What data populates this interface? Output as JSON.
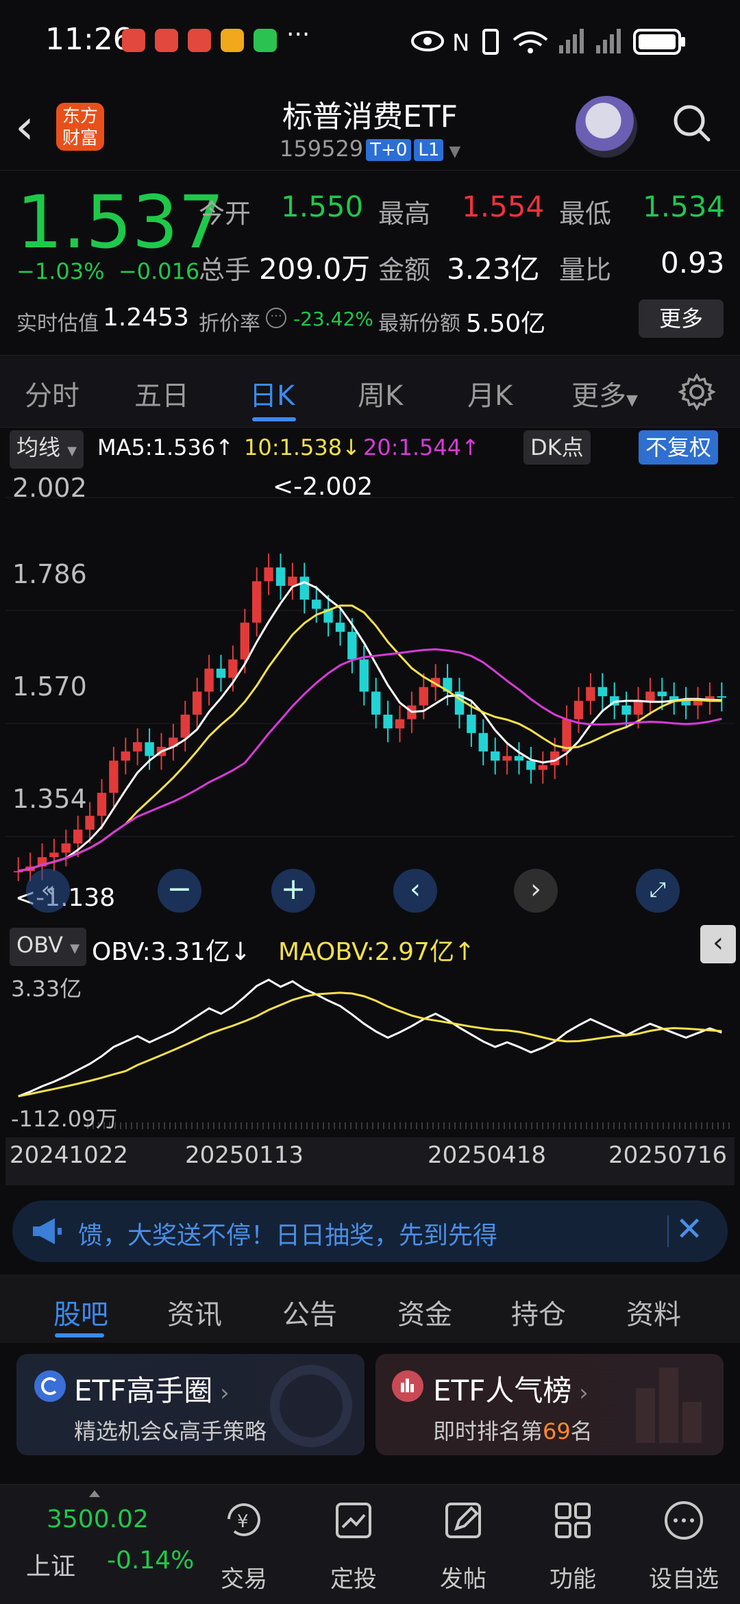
{
  "status": {
    "time": "11:26",
    "more": "···"
  },
  "header": {
    "logo_line1": "东方",
    "logo_line2": "财富",
    "title": "标普消费ETF",
    "code": "159529",
    "badge1": "T+0",
    "badge2": "L1"
  },
  "quote": {
    "price": "1.537",
    "change_pct": "−1.03%",
    "change_abs": "−0.016",
    "open_label": "今开",
    "open": "1.550",
    "high_label": "最高",
    "high": "1.554",
    "low_label": "最低",
    "low": "1.534",
    "volume_label": "总手",
    "volume": "209.0万",
    "amount_label": "金额",
    "amount": "3.23亿",
    "ratio_label": "量比",
    "ratio": "0.93",
    "iopv_label": "实时估值",
    "iopv": "1.2453",
    "premium_label": "折价率",
    "premium": "-23.42%",
    "shares_label": "最新份额",
    "shares": "5.50亿",
    "more": "更多"
  },
  "ktabs": [
    "分时",
    "五日",
    "日K",
    "周K",
    "月K",
    "更多"
  ],
  "ma": {
    "selector": "均线",
    "ma5": "MA5:1.536↑",
    "ma10": "10:1.538↓",
    "ma20": "20:1.544↑",
    "dk": "DK点",
    "adjust": "不复权"
  },
  "chart_labels": {
    "max_marker": "<-2.002",
    "min_marker": "<-1.138",
    "y_ticks": [
      "2.002",
      "1.786",
      "1.570",
      "1.354"
    ]
  },
  "obv": {
    "selector": "OBV",
    "obv": "OBV:3.31亿↓",
    "maobv": "MAOBV:2.97亿↑",
    "top": "3.33亿",
    "bottom": "-112.09万"
  },
  "dates": [
    "20241022",
    "20250113",
    "20250418",
    "20250716"
  ],
  "banner": {
    "text": "馈，大奖送不停！日日抽奖，先到先得"
  },
  "stabs": [
    "股吧",
    "资讯",
    "公告",
    "资金",
    "持仓",
    "资料"
  ],
  "cards": {
    "left_title": "ETF高手圈",
    "left_sub": "精选机会&高手策略",
    "right_title": "ETF人气榜",
    "right_sub_pre": "即时排名第",
    "right_rank": "69",
    "right_sub_post": "名"
  },
  "footer": {
    "index_value": "3500.02",
    "index_name": "上证",
    "index_change": "-0.14%",
    "items": [
      "交易",
      "定投",
      "发帖",
      "功能",
      "设自选"
    ]
  },
  "chart_data": {
    "type": "candlestick",
    "y_range": [
      1.138,
      2.002
    ],
    "x_range": [
      "20241022",
      "20250716"
    ],
    "close": [
      1.16,
      1.17,
      1.19,
      1.2,
      1.22,
      1.25,
      1.28,
      1.33,
      1.4,
      1.42,
      1.44,
      1.41,
      1.43,
      1.45,
      1.5,
      1.55,
      1.6,
      1.58,
      1.62,
      1.7,
      1.79,
      1.82,
      1.78,
      1.8,
      1.75,
      1.73,
      1.7,
      1.68,
      1.62,
      1.55,
      1.5,
      1.47,
      1.49,
      1.52,
      1.56,
      1.58,
      1.55,
      1.5,
      1.46,
      1.42,
      1.4,
      1.41,
      1.4,
      1.38,
      1.39,
      1.42,
      1.49,
      1.53,
      1.56,
      1.54,
      1.52,
      1.5,
      1.53,
      1.55,
      1.54,
      1.53,
      1.52,
      1.53,
      1.54,
      1.537
    ],
    "ma5_last": 1.536,
    "ma10_last": 1.538,
    "ma20_last": 1.544,
    "obv_range": [
      "-112.09万",
      "3.33亿"
    ]
  }
}
